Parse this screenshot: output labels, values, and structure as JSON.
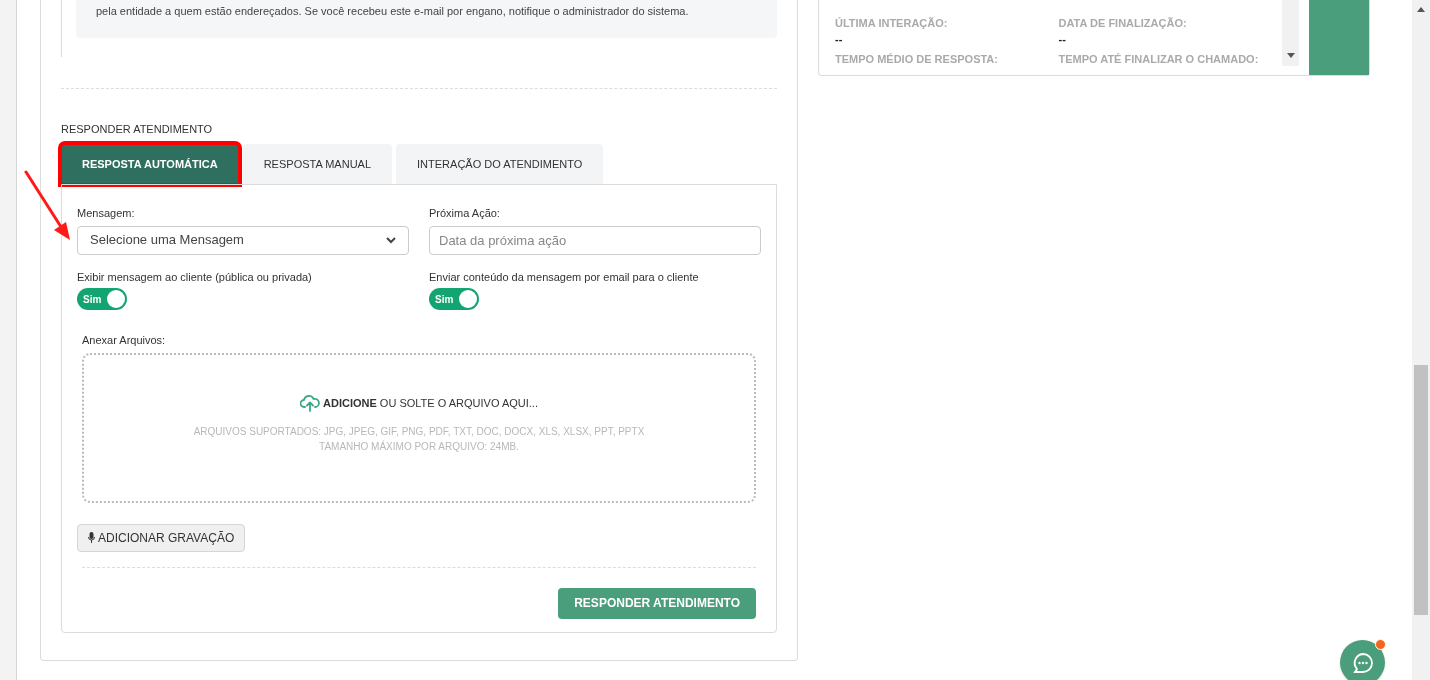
{
  "email_notice": {
    "text": "pela entidade a quem estão endereçados. Se você recebeu este e-mail por engano, notifique o administrador do sistema."
  },
  "section_title": "RESPONDER ATENDIMENTO",
  "tabs": [
    {
      "label": "RESPOSTA AUTOMÁTICA",
      "selected": true,
      "highlighted": true
    },
    {
      "label": "RESPOSTA MANUAL",
      "selected": false,
      "highlighted": false
    },
    {
      "label": "INTERAÇÃO DO ATENDIMENTO",
      "selected": false,
      "highlighted": false
    }
  ],
  "form": {
    "message": {
      "label": "Mensagem:",
      "value": "Selecione uma Mensagem"
    },
    "next_action": {
      "label": "Próxima Ação:",
      "placeholder": "Data da próxima ação"
    },
    "toggles": [
      {
        "label": "Exibir mensagem ao cliente (pública ou privada)",
        "state_label": "Sim",
        "on": true
      },
      {
        "label": "Enviar conteúdo da mensagem por email para o cliente",
        "state_label": "Sim",
        "on": true
      }
    ],
    "attachments": {
      "label": "Anexar Arquivos:",
      "prompt": "**ADICIONE** OU SOLTE O ARQUIVO AQUI...",
      "formats": "ARQUIVOS SUPORTADOS: JPG, JPEG, GIF, PNG, PDF, TXT, DOC, DOCX, XLS, XLSX, PPT, PPTX",
      "max_size": "TAMANHO MÁXIMO POR ARQUIVO: 24MB."
    },
    "record_button": "ADICIONAR GRAVAÇÃO",
    "submit_button": "RESPONDER ATENDIMENTO"
  },
  "details": {
    "fields": [
      {
        "label": "ÚLTIMA INTERAÇÃO:",
        "value": "--"
      },
      {
        "label": "DATA DE FINALIZAÇÃO:",
        "value": "--"
      },
      {
        "label": "TEMPO MÉDIO DE RESPOSTA:"
      },
      {
        "label": "TEMPO ATÉ FINALIZAR O CHAMADO:"
      }
    ]
  },
  "chat": {
    "unread": true
  }
}
